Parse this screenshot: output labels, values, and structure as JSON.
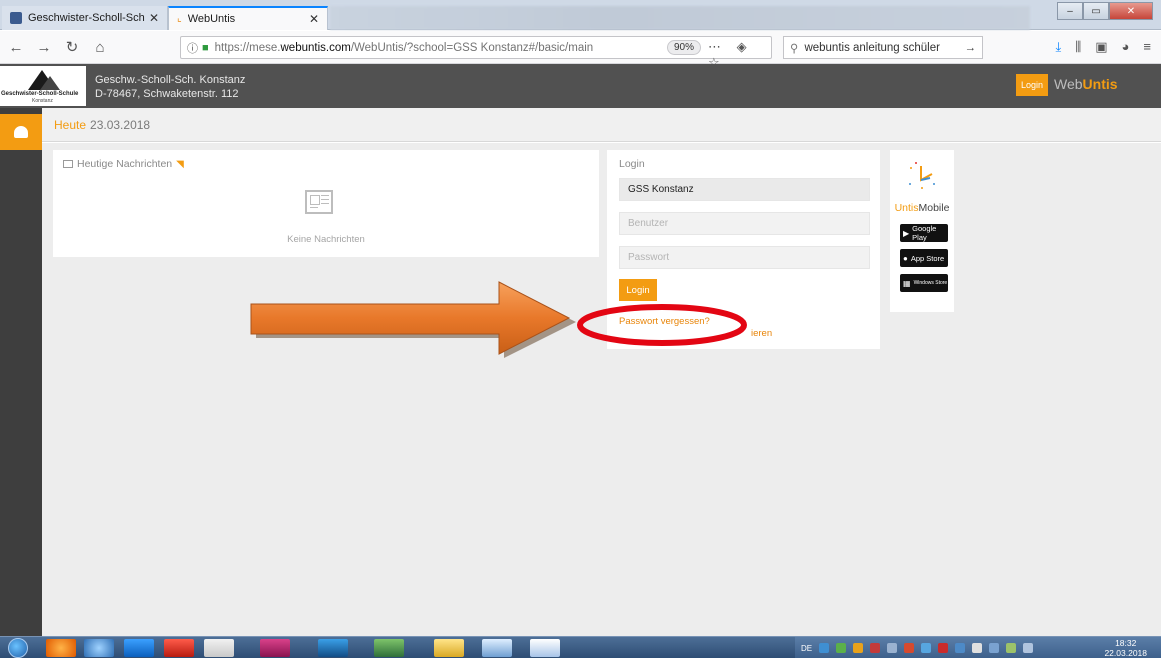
{
  "browser": {
    "tabs": [
      {
        "title": "Geschwister-Scholl-Schule Kon",
        "active": false
      },
      {
        "title": "WebUntis",
        "active": true
      }
    ],
    "url_prefix": "https://mese.",
    "url_domain": "webuntis.com",
    "url_path": "/WebUntis/?school=GSS Konstanz#/basic/main",
    "zoom": "90%",
    "search_text": "webuntis anleitung schüler"
  },
  "header": {
    "school_logo_name": "Geschwister-Scholl-Schule",
    "school_logo_city": "Konstanz",
    "school_name": "Geschw.-Scholl-Sch. Konstanz",
    "school_address": "D-78467, Schwaketenstr. 112",
    "login_label": "Login",
    "brand_web": "Web",
    "brand_untis": "Untis"
  },
  "datebar": {
    "today_label": "Heute",
    "date": "23.03.2018"
  },
  "news": {
    "title": "Heutige Nachrichten",
    "empty_text": "Keine Nachrichten"
  },
  "login": {
    "title": "Login",
    "school_value": "GSS Konstanz",
    "user_placeholder": "Benutzer",
    "password_placeholder": "Passwort",
    "button_label": "Login",
    "forgot_link": "Passwort vergessen?",
    "register_link": "ieren"
  },
  "mobile": {
    "untis": "Untis",
    "mobile": "Mobile",
    "google_play": "Google Play",
    "app_store": "App Store",
    "windows_store": "Windows Store"
  },
  "taskbar": {
    "language": "DE",
    "time": "18:32",
    "date": "22.03.2018"
  },
  "colors": {
    "accent": "#f39c12",
    "header_bg": "#515151",
    "annotation_arrow": "#e8782a",
    "annotation_ellipse": "#e30613"
  }
}
